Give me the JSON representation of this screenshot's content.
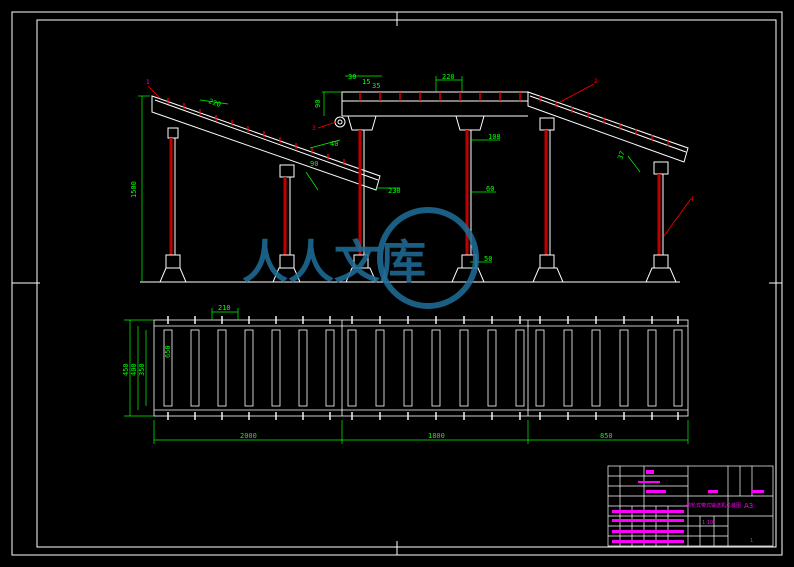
{
  "drawing": {
    "dimensions": {
      "top_left_pitch": "220",
      "top_center_span": "220",
      "left_height": "1500",
      "left_small_a": "40",
      "left_small_b": "90",
      "left_small_c": "230",
      "top_small_a": "30",
      "top_small_b": "15",
      "top_small_c": "35",
      "top_height": "90",
      "center_small_a": "108",
      "center_small_b": "60",
      "center_small_c": "50",
      "right_small": "37",
      "plan_pitch": "210",
      "plan_width_a": "450",
      "plan_width_b": "400",
      "plan_width_c": "350",
      "plan_width_inner": "650",
      "plan_len_left": "2000",
      "plan_len_mid": "1800",
      "plan_len_right": "850"
    },
    "balloons": [
      "1",
      "2",
      "3",
      "4"
    ],
    "watermark": "人人文库"
  },
  "title_block": {
    "sheet_size": "A3",
    "drawing_name": "滚轮式带式输送机总装图",
    "scale": "1:10",
    "sheet_no": "1"
  }
}
